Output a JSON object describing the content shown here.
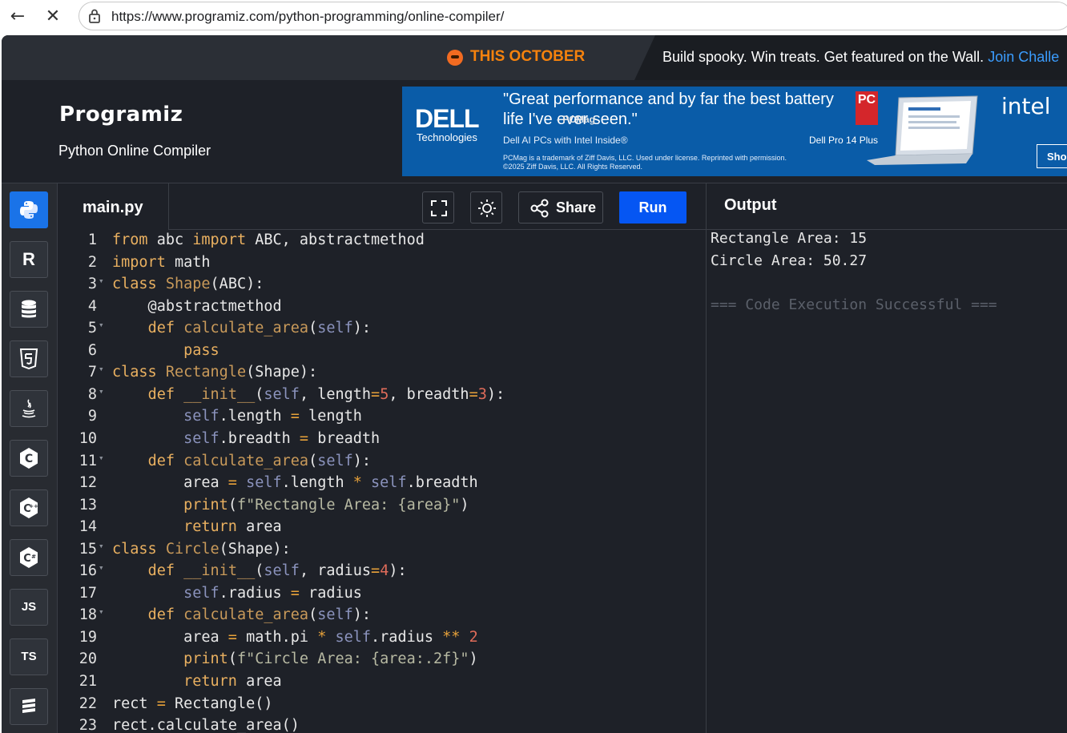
{
  "browser": {
    "back_icon": "back-arrow-icon",
    "close_icon": "close-icon",
    "url": "https://www.programiz.com/python-programming/online-compiler/"
  },
  "promo": {
    "left_text": "THIS OCTOBER",
    "main_text": "Build spooky. Win treats. Get featured on the Wall.",
    "link_text": "Join Challe"
  },
  "header": {
    "logo": "Programiz",
    "subtitle": "Python Online Compiler"
  },
  "ad": {
    "brand": "DELL",
    "brand_sub": "Technologies",
    "quote": "\"Great performance and by far the best battery life I've ever seen.\"",
    "quote_source": "- PCMag",
    "line": "Dell AI PCs with Intel Inside®",
    "fine_print": "PCMag is a trademark of Ziff Davis, LLC. Used under license. Reprinted with permission. ©2025 Ziff Davis, LLC. All Rights Reserved.",
    "badge": "PC",
    "model": "Dell Pro 14 Plus",
    "partner": "intel",
    "cta": "Sho"
  },
  "languages": [
    {
      "name": "python",
      "label": ""
    },
    {
      "name": "r",
      "label": "R"
    },
    {
      "name": "sql",
      "label": ""
    },
    {
      "name": "html",
      "label": "5"
    },
    {
      "name": "java",
      "label": ""
    },
    {
      "name": "c",
      "label": "C"
    },
    {
      "name": "cpp",
      "label": "C"
    },
    {
      "name": "csharp",
      "label": "C"
    },
    {
      "name": "js",
      "label": "JS"
    },
    {
      "name": "ts",
      "label": "TS"
    },
    {
      "name": "swift",
      "label": ""
    }
  ],
  "editor": {
    "file_name": "main.py",
    "share_label": "Share",
    "run_label": "Run"
  },
  "output": {
    "title": "Output",
    "lines": [
      "Rectangle Area: 15",
      "Circle Area: 50.27",
      "",
      "=== Code Execution Successful ==="
    ]
  },
  "code_lines": [
    {
      "n": "1",
      "t": "from abc import ABC, abstractmethod"
    },
    {
      "n": "2",
      "t": "import math"
    },
    {
      "n": "3",
      "t": "class Shape(ABC):"
    },
    {
      "n": "4",
      "t": "    @abstractmethod"
    },
    {
      "n": "5",
      "t": "    def calculate_area(self):"
    },
    {
      "n": "6",
      "t": "        pass"
    },
    {
      "n": "7",
      "t": "class Rectangle(Shape):"
    },
    {
      "n": "8",
      "t": "    def __init__(self, length=5, breadth=3):"
    },
    {
      "n": "9",
      "t": "        self.length = length"
    },
    {
      "n": "10",
      "t": "        self.breadth = breadth"
    },
    {
      "n": "11",
      "t": "    def calculate_area(self):"
    },
    {
      "n": "12",
      "t": "        area = self.length * self.breadth"
    },
    {
      "n": "13",
      "t": "        print(f\"Rectangle Area: {area}\")"
    },
    {
      "n": "14",
      "t": "        return area"
    },
    {
      "n": "15",
      "t": "class Circle(Shape):"
    },
    {
      "n": "16",
      "t": "    def __init__(self, radius=4):"
    },
    {
      "n": "17",
      "t": "        self.radius = radius"
    },
    {
      "n": "18",
      "t": "    def calculate_area(self):"
    },
    {
      "n": "19",
      "t": "        area = math.pi * self.radius ** 2"
    },
    {
      "n": "20",
      "t": "        print(f\"Circle Area: {area:.2f}\")"
    },
    {
      "n": "21",
      "t": "        return area"
    },
    {
      "n": "22",
      "t": "rect = Rectangle()"
    },
    {
      "n": "23",
      "t": "rect.calculate_area()"
    }
  ]
}
